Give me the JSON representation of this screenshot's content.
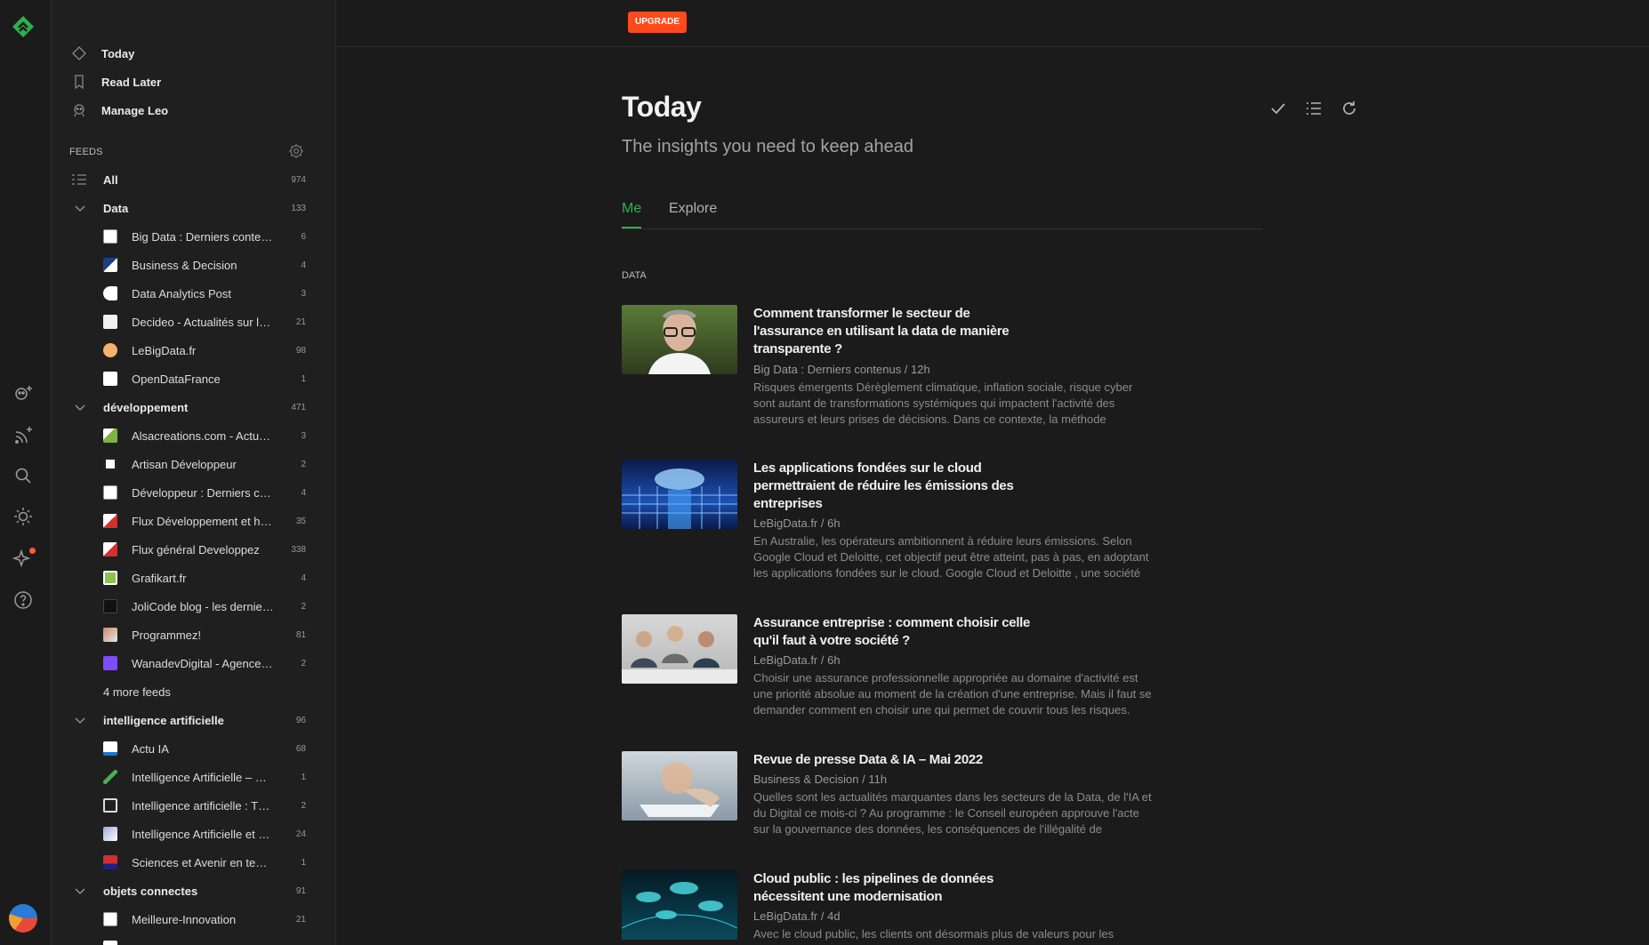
{
  "nav": {
    "today": "Today",
    "read_later": "Read Later",
    "manage_leo": "Manage Leo"
  },
  "feeds_label": "FEEDS",
  "all": {
    "label": "All",
    "count": "974"
  },
  "categories": [
    {
      "label": "Data",
      "count": "133",
      "feeds": [
        {
          "label": "Big Data : Derniers conte…",
          "count": "6"
        },
        {
          "label": "Business & Decision",
          "count": "4"
        },
        {
          "label": "Data Analytics Post",
          "count": "3"
        },
        {
          "label": "Decideo - Actualités sur l…",
          "count": "21"
        },
        {
          "label": "LeBigData.fr",
          "count": "98"
        },
        {
          "label": "OpenDataFrance",
          "count": "1"
        }
      ]
    },
    {
      "label": "développement",
      "count": "471",
      "feeds": [
        {
          "label": "Alsacreations.com - Actu…",
          "count": "3"
        },
        {
          "label": "Artisan Développeur",
          "count": "2"
        },
        {
          "label": "Développeur : Derniers c…",
          "count": "4"
        },
        {
          "label": "Flux Développement et h…",
          "count": "35"
        },
        {
          "label": "Flux général Developpez",
          "count": "338"
        },
        {
          "label": "Grafikart.fr",
          "count": "4"
        },
        {
          "label": "JoliCode blog - les dernie…",
          "count": "2"
        },
        {
          "label": "Programmez!",
          "count": "81"
        },
        {
          "label": "WanadevDigital - Agence…",
          "count": "2"
        }
      ],
      "more": "4 more feeds"
    },
    {
      "label": "intelligence artificielle",
      "count": "96",
      "feeds": [
        {
          "label": "Actu IA",
          "count": "68"
        },
        {
          "label": "Intelligence Artificielle – …",
          "count": "1"
        },
        {
          "label": "Intelligence artificielle : T…",
          "count": "2"
        },
        {
          "label": "Intelligence Artificielle et …",
          "count": "24"
        },
        {
          "label": "Sciences et Avenir en te…",
          "count": "1"
        }
      ]
    },
    {
      "label": "objets connectes",
      "count": "91",
      "feeds": [
        {
          "label": "Meilleure-Innovation",
          "count": "21"
        }
      ]
    }
  ],
  "topbar": {
    "upgrade": "UPGRADE"
  },
  "page": {
    "title": "Today",
    "subtitle": "The insights you need to keep ahead",
    "tabs": [
      "Me",
      "Explore"
    ],
    "section": "DATA"
  },
  "articles": [
    {
      "title": "Comment transformer le secteur de l'assurance en utilisant la data de manière transparente ?",
      "meta": "Big Data : Derniers contenus / 12h",
      "summary": "Risques émergents Dérèglement climatique, inflation sociale, risque cyber sont autant de transformations systémiques qui impactent l'activité des assureurs et leurs prises de décisions. Dans ce contexte, la méthode"
    },
    {
      "title": "Les applications fondées sur le cloud permettraient de réduire les émissions des entreprises",
      "meta": "LeBigData.fr / 6h",
      "summary": "En Australie, les opérateurs ambitionnent à réduire leurs émissions. Selon Google Cloud et Deloitte, cet objectif peut être atteint, pas à pas, en adoptant les applications fondées sur le cloud. Google Cloud et Deloitte , une société"
    },
    {
      "title": "Assurance entreprise : comment choisir celle qu'il faut à votre société ?",
      "meta": "LeBigData.fr / 6h",
      "summary": "Choisir une assurance professionnelle appropriée au domaine d'activité est une priorité absolue au moment de la création d'une entreprise. Mais il faut se demander comment en choisir une qui permet de couvrir tous les risques."
    },
    {
      "title": "Revue de presse Data & IA – Mai 2022",
      "meta": "Business & Decision / 11h",
      "summary": "Quelles sont les actualités marquantes dans les secteurs de la Data, de l'IA et du Digital ce mois-ci ? Au programme : le Conseil européen approuve l'acte sur la gouvernance des données, les conséquences de l'illégalité de"
    },
    {
      "title": "Cloud public : les pipelines de données nécessitent une modernisation",
      "meta": "LeBigData.fr / 4d",
      "summary": "Avec le cloud public, les clients ont désormais plus de valeurs pour les"
    }
  ],
  "colors": {
    "accent": "#2bb24c",
    "upgrade": "#ff4a1c",
    "background": "#1b1b1b"
  },
  "icons": [
    "feedly-logo-icon",
    "today-icon",
    "bookmark-icon",
    "leo-icon",
    "gear-icon",
    "chevron-down-icon",
    "mark-read-icon",
    "list-view-icon",
    "refresh-icon",
    "add-leo-icon",
    "add-feed-icon",
    "search-icon",
    "theme-icon",
    "sparkle-icon",
    "help-icon",
    "avatar"
  ]
}
